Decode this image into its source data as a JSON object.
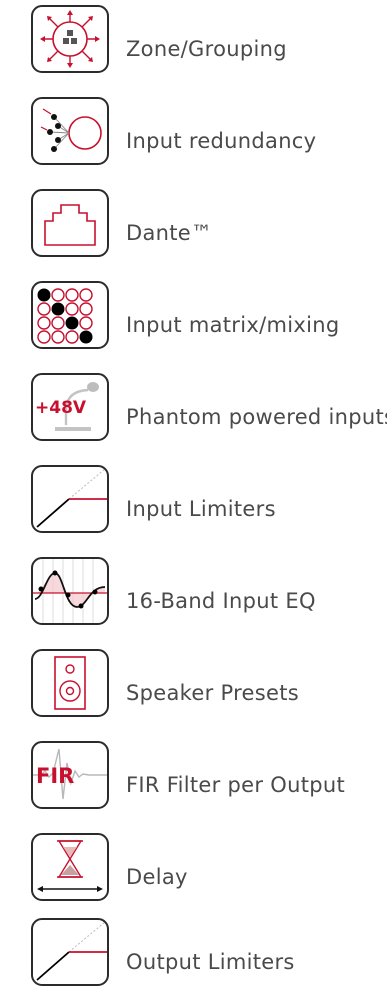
{
  "features": [
    {
      "label": "Zone/Grouping",
      "icon": "zone-grouping-icon"
    },
    {
      "label": "Input redundancy",
      "icon": "input-redundancy-icon"
    },
    {
      "label": "Dante™",
      "icon": "dante-network-port-icon"
    },
    {
      "label": "Input matrix/mixing",
      "icon": "matrix-grid-icon"
    },
    {
      "label": "Phantom powered inputs",
      "icon": "phantom-power-microphone-icon",
      "badge": "+48V"
    },
    {
      "label": "Input Limiters",
      "icon": "limiter-curve-icon"
    },
    {
      "label": "16-Band Input EQ",
      "icon": "eq-curve-icon"
    },
    {
      "label": "Speaker Presets",
      "icon": "speaker-icon"
    },
    {
      "label": "FIR Filter per Output",
      "icon": "fir-filter-icon",
      "badge": "FIR"
    },
    {
      "label": "Delay",
      "icon": "hourglass-delay-icon"
    },
    {
      "label": "Output Limiters",
      "icon": "limiter-curve-icon"
    }
  ],
  "colors": {
    "accent": "#c8102e",
    "outline": "#2b2b2b",
    "text": "#4a4a4a",
    "muted": "#b8b8b8"
  }
}
